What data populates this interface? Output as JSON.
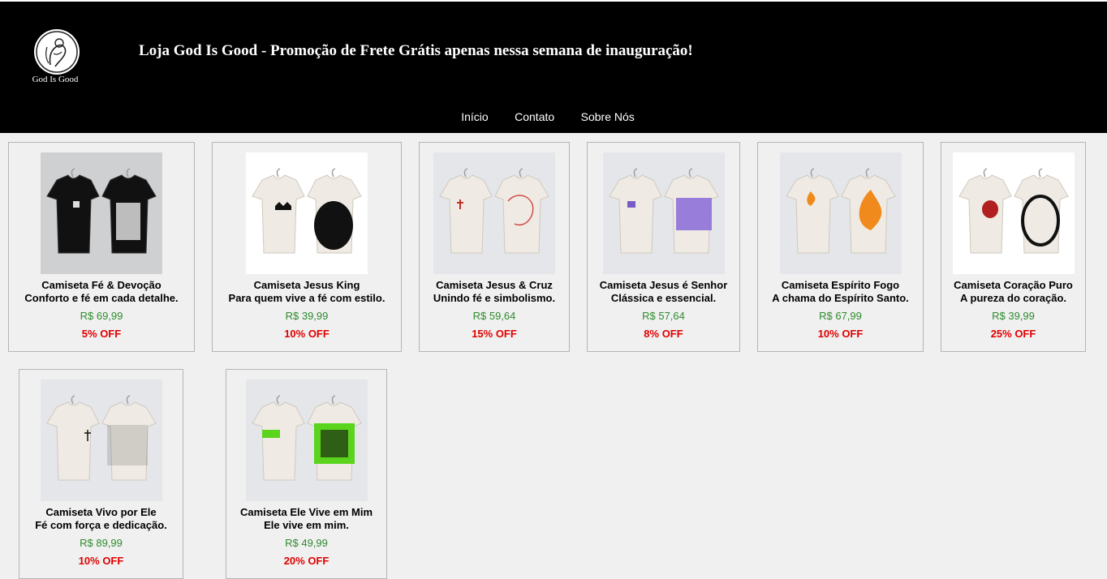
{
  "header": {
    "logo_text": "God Is Good",
    "title": "Loja God Is Good - Promoção de Frete Grátis apenas nessa semana de inauguração!"
  },
  "nav": {
    "items": [
      "Início",
      "Contato",
      "Sobre Nós"
    ]
  },
  "products": [
    {
      "name": "Camiseta Fé & Devoção",
      "desc": "Conforto e fé em cada detalhe.",
      "price": "R$ 69,99",
      "discount": "5% OFF",
      "image": "tshirt-black-pair",
      "bg": "#cfd0d2"
    },
    {
      "name": "Camiseta Jesus King",
      "desc": "Para quem vive a fé com estilo.",
      "price": "R$ 39,99",
      "discount": "10% OFF",
      "image": "tshirt-crown-jesus-king",
      "bg": "#ffffff"
    },
    {
      "name": "Camiseta Jesus & Cruz",
      "desc": "Unindo fé e simbolismo.",
      "price": "R$ 59,64",
      "discount": "15% OFF",
      "image": "tshirt-cross-jesus",
      "bg": "#e4e6e9"
    },
    {
      "name": "Camiseta Jesus é Senhor",
      "desc": "Clássica e essencial.",
      "price": "R$ 57,64",
      "discount": "8% OFF",
      "image": "tshirt-jesus-senhor",
      "bg": "#e4e6e9"
    },
    {
      "name": "Camiseta Espírito Fogo",
      "desc": "A chama do Espírito Santo.",
      "price": "R$ 67,99",
      "discount": "10% OFF",
      "image": "tshirt-fire",
      "bg": "#e4e6e9"
    },
    {
      "name": "Camiseta Coração Puro",
      "desc": "A pureza do coração.",
      "price": "R$ 39,99",
      "discount": "25% OFF",
      "image": "tshirt-heart",
      "bg": "#ffffff"
    },
    {
      "name": "Camiseta Vivo por Ele",
      "desc": "Fé com força e dedicação.",
      "price": "R$ 89,99",
      "discount": "10% OFF",
      "image": "tshirt-vivo-por-ele",
      "bg": "#e4e6e9"
    },
    {
      "name": "Camiseta Ele Vive em Mim",
      "desc": "Ele vive em mim.",
      "price": "R$ 49,99",
      "discount": "20% OFF",
      "image": "tshirt-ele-vive-green",
      "bg": "#e4e6e9"
    }
  ],
  "colors": {
    "header_bg": "#000000",
    "price": "#2e8b2e",
    "discount": "#e00000",
    "page_bg": "#f0f0f0"
  }
}
